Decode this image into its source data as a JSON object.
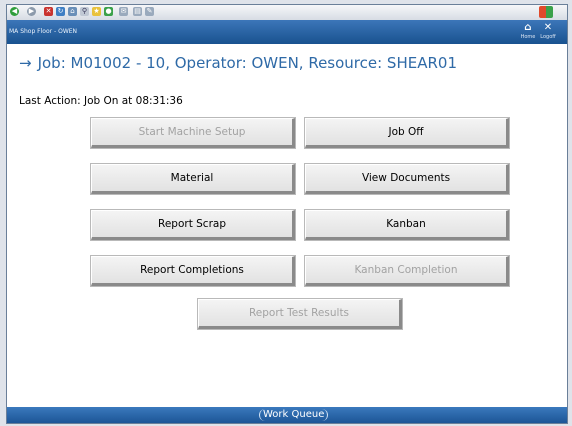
{
  "titlebar": {
    "app_title": "MA Shop Floor  -  OWEN",
    "home_label": "Home",
    "logoff_label": "Logoff"
  },
  "header": {
    "text": "Job: M01002 - 10, Operator: OWEN, Resource: SHEAR01"
  },
  "status": {
    "last_action": "Last Action: Job On at 08:31:36"
  },
  "buttons": {
    "start_machine_setup": "Start Machine Setup",
    "job_off": "Job Off",
    "material": "Material",
    "view_documents": "View Documents",
    "report_scrap": "Report Scrap",
    "kanban": "Kanban",
    "report_completions": "Report Completions",
    "kanban_completion": "Kanban Completion",
    "report_test_results": "Report Test Results"
  },
  "footer": {
    "work_queue": "Work Queue"
  },
  "colors": {
    "title_blue": "#19528f",
    "header_text": "#2f6aa7",
    "disabled_text": "#a2a2a2"
  }
}
